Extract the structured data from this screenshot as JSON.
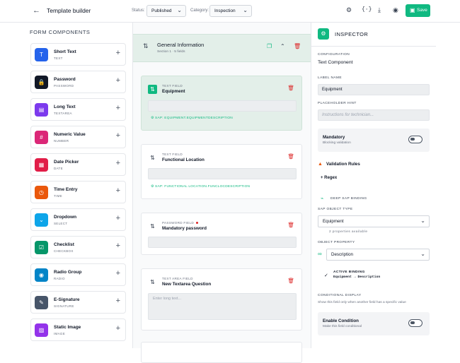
{
  "topbar": {
    "back_icon": "arrow-left",
    "title": "Template builder",
    "status_label": "Status:",
    "status_value": "Published",
    "category_label": "Category:",
    "category_value": "Inspection",
    "save_label": "Save",
    "accent": "#10b981"
  },
  "left": {
    "header": "FORM COMPONENTS",
    "components": [
      {
        "name": "Short Text",
        "type": "TEXT",
        "color": "#2563eb",
        "icon": "text-icon"
      },
      {
        "name": "Password",
        "type": "PASSWORD",
        "color": "#111827",
        "icon": "lock-icon"
      },
      {
        "name": "Long Text",
        "type": "TEXTAREA",
        "color": "#7c3aed",
        "icon": "document-icon"
      },
      {
        "name": "Numeric Value",
        "type": "NUMBER",
        "color": "#db2777",
        "icon": "hash-icon"
      },
      {
        "name": "Date Picker",
        "type": "DATE",
        "color": "#e11d48",
        "icon": "calendar-icon"
      },
      {
        "name": "Time Entry",
        "type": "TIME",
        "color": "#ea580c",
        "icon": "clock-icon"
      },
      {
        "name": "Dropdown",
        "type": "SELECT",
        "color": "#0ea5e9",
        "icon": "chevron-icon"
      },
      {
        "name": "Checklist",
        "type": "CHECKBOX",
        "color": "#059669",
        "icon": "checkbox-icon"
      },
      {
        "name": "Radio Group",
        "type": "RADIO",
        "color": "#0284c7",
        "icon": "radio-icon"
      },
      {
        "name": "E-Signature",
        "type": "SIGNATURE",
        "color": "#475569",
        "icon": "pen-icon"
      },
      {
        "name": "Static Image",
        "type": "IMAGE",
        "color": "#9333ea",
        "icon": "image-icon"
      }
    ]
  },
  "canvas": {
    "section_title": "General Information",
    "section_sub": "Section 1 · 5 fields",
    "fields": [
      {
        "type": "TEXT FIELD",
        "name": "Equipment",
        "placeholder": "",
        "sap": "SAP: EQUIPMENT.EQUIPMENTDESCRIPTION"
      },
      {
        "type": "TEXT FIELD",
        "name": "Functional Location",
        "placeholder": "",
        "sap": "SAP: FUNCTIONAL LOCATION.FUNCLOCDESCRIPTION"
      },
      {
        "type": "PASSWORD FIELD",
        "name": "Mandatory password",
        "placeholder": ""
      },
      {
        "type": "TEXT AREA FIELD",
        "name": "New Textarea Question",
        "placeholder": "Enter long text..."
      }
    ]
  },
  "inspector": {
    "title": "INSPECTOR",
    "configuration_cap": "CONFIGURATION",
    "configuration_value": "Text Component",
    "label_name_cap": "LABEL NAME",
    "label_name_value": "Equipment",
    "placeholder_cap": "PLACEHOLDER HINT",
    "placeholder_value": "Instructions for technician...",
    "mandatory_title": "Mandatory",
    "mandatory_sub": "Blocking validation",
    "validation_title": "Validation Rules",
    "regex_label": "+ Regex",
    "deep_sap_label": "DEEP SAP BINDING",
    "sap_object_cap": "SAP OBJECT TYPE",
    "sap_object_value": "Equipment",
    "properties_available": "2 properties available",
    "object_property_cap": "OBJECT PROPERTY",
    "object_property_value": "Description",
    "active_binding_cap": "ACTIVE BINDING",
    "active_binding_value": "Equipment → Description",
    "conditional_cap": "CONDITIONAL DISPLAY",
    "conditional_sub": "Show this field only when another field has a specific value",
    "enable_title": "Enable Condition",
    "enable_sub": "Make this field conditional"
  }
}
